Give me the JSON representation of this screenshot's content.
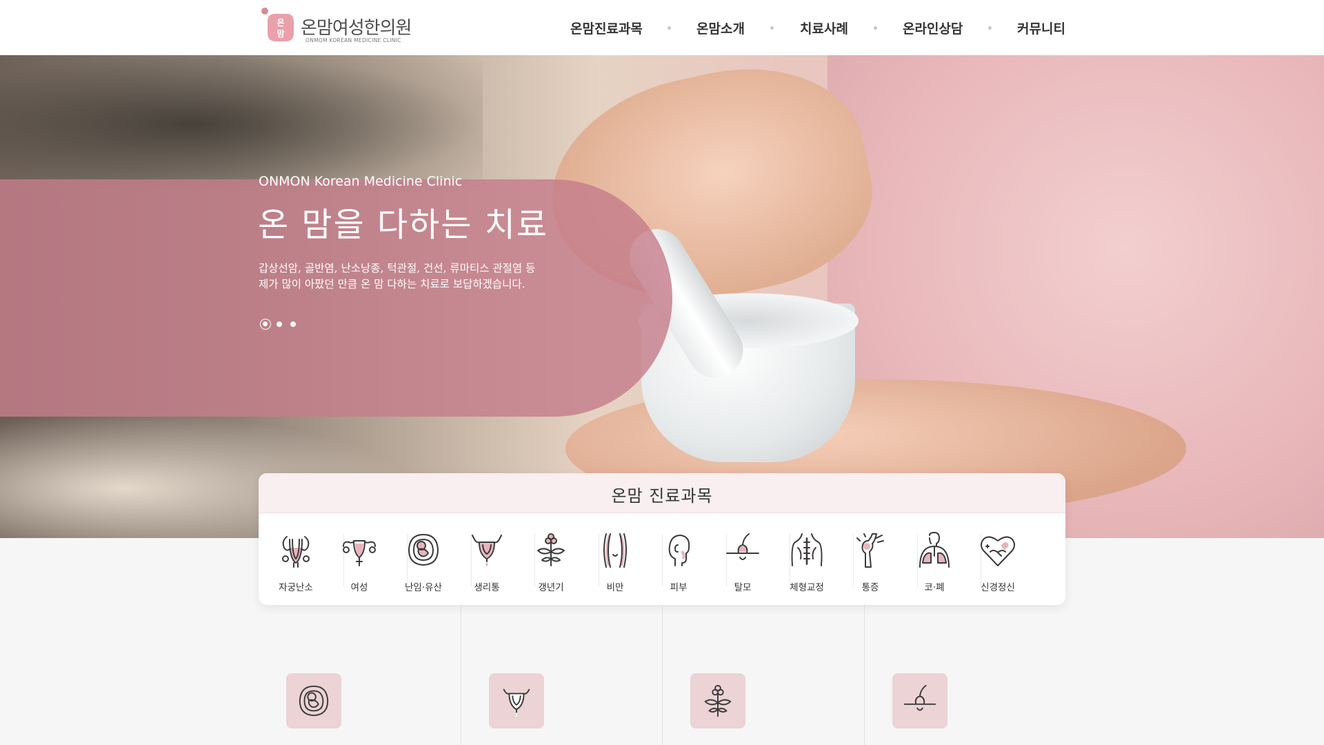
{
  "header": {
    "logo_name": "온맘여성한의원",
    "logo_sub": "ONMOM KOREAN MEDICINE CLINIC",
    "logo_mark_text": "온맘",
    "nav": [
      "온맘진료과목",
      "온맘소개",
      "치료사례",
      "온라인상담",
      "커뮤니티"
    ]
  },
  "hero": {
    "kicker": "ONMON Korean Medicine Clinic",
    "title": "온 맘을 다하는 치료",
    "desc_line1": "갑상선암, 골반염, 난소낭종, 턱관절, 건선, 류마티스 관절염 등",
    "desc_line2": "제가 많이 아팠던 만큼 온 맘 다하는 치료로 보답하겠습니다.",
    "slides_total": 3,
    "slide_active": 1,
    "panel_color": "#c47e8b"
  },
  "departments": {
    "title": "온맘 진료과목",
    "items": [
      {
        "label": "자궁난소",
        "icon": "uterus-ovary-icon"
      },
      {
        "label": "여성",
        "icon": "female-reproductive-icon"
      },
      {
        "label": "난임·유산",
        "icon": "fetus-icon"
      },
      {
        "label": "생리통",
        "icon": "menstrual-uterus-icon"
      },
      {
        "label": "갱년기",
        "icon": "flower-icon"
      },
      {
        "label": "비만",
        "icon": "body-silhouette-icon"
      },
      {
        "label": "피부",
        "icon": "face-profile-icon"
      },
      {
        "label": "탈모",
        "icon": "hair-follicle-icon"
      },
      {
        "label": "체형교정",
        "icon": "spine-back-icon"
      },
      {
        "label": "통증",
        "icon": "knee-joint-icon"
      },
      {
        "label": "코·폐",
        "icon": "lungs-icon"
      },
      {
        "label": "신경정신",
        "icon": "heart-hands-icon"
      }
    ]
  },
  "features": [
    {
      "icon": "fetus-icon"
    },
    {
      "icon": "menstrual-uterus-icon"
    },
    {
      "icon": "flower-icon"
    },
    {
      "icon": "hair-follicle-icon"
    }
  ],
  "colors": {
    "accent": "#c47e8b",
    "tile": "#ebd3d6",
    "card_head": "#f9eef0"
  }
}
